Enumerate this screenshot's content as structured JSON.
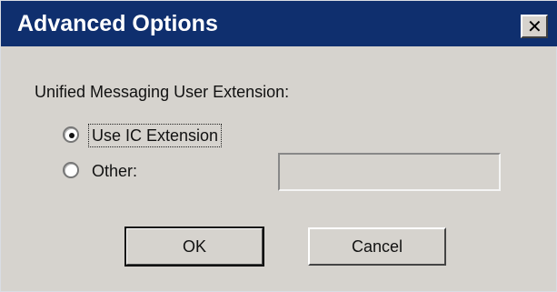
{
  "window": {
    "title": "Advanced Options",
    "close_icon": "close-icon",
    "close_glyph": "✕"
  },
  "main": {
    "group_label": "Unified Messaging User Extension:",
    "options": [
      {
        "label": "Use IC Extension",
        "selected": true
      },
      {
        "label": "Other:",
        "selected": false
      }
    ],
    "other_value": ""
  },
  "buttons": {
    "ok": "OK",
    "cancel": "Cancel"
  },
  "colors": {
    "titlebar": "#0f2f6e",
    "dialog_background": "#d6d3ce"
  }
}
